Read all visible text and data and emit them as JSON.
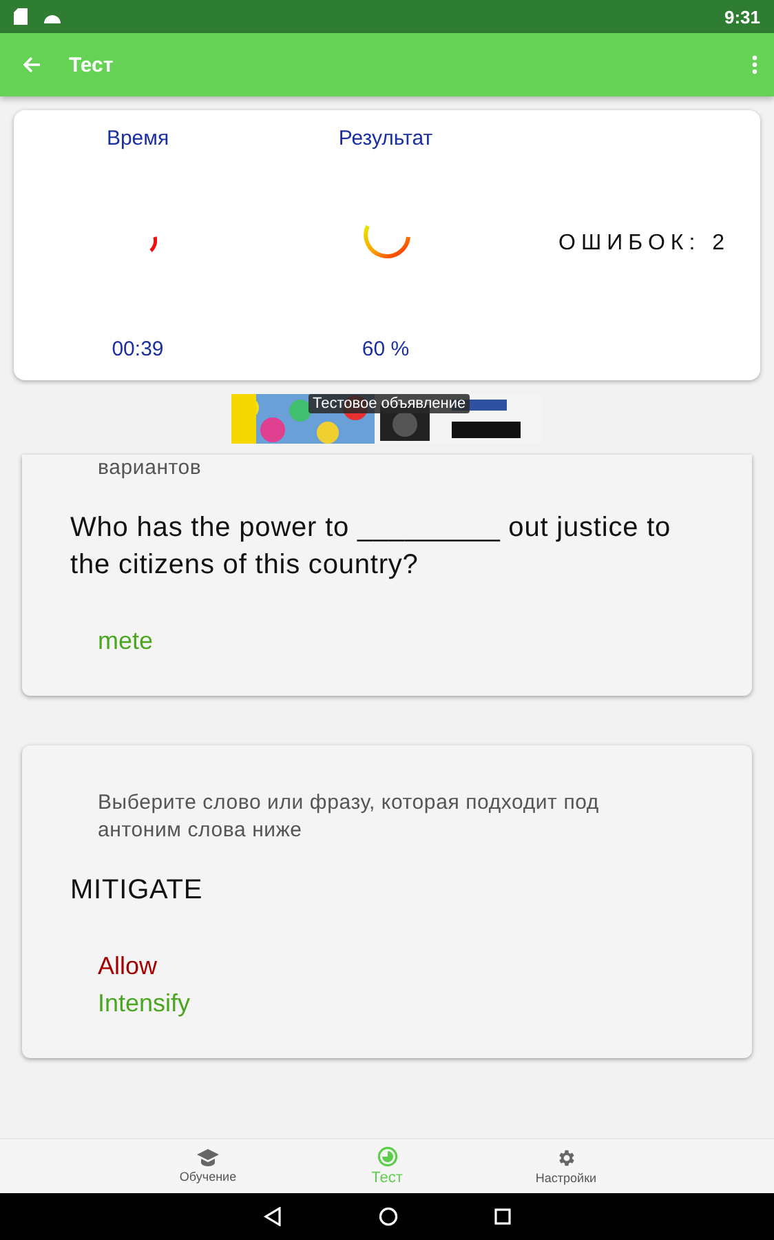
{
  "status_bar": {
    "time": "9:31"
  },
  "app_bar": {
    "title": "Тест"
  },
  "stats": {
    "time": {
      "label": "Время",
      "reading": "00:39"
    },
    "result": {
      "label": "Результат",
      "reading": "60 %"
    },
    "errors": "ОШИБОК: 2"
  },
  "ad": {
    "label": "Тестовое объявление"
  },
  "questions": [
    {
      "prompt": "вариантов",
      "question": "Who has the power to _________ out justice to the citizens of this country?",
      "answers": [
        {
          "text": "mete",
          "correct": true
        }
      ]
    },
    {
      "prompt": "Выберите слово или фразу, которая подходит под антоним слова ниже",
      "question": "MITIGATE",
      "answers": [
        {
          "text": "Allow",
          "correct": false
        },
        {
          "text": "Intensify",
          "correct": true
        }
      ]
    }
  ],
  "bottom_nav": [
    {
      "label": "Обучение",
      "selected": false
    },
    {
      "label": "Тест",
      "selected": true
    },
    {
      "label": "Настройки",
      "selected": false
    }
  ]
}
